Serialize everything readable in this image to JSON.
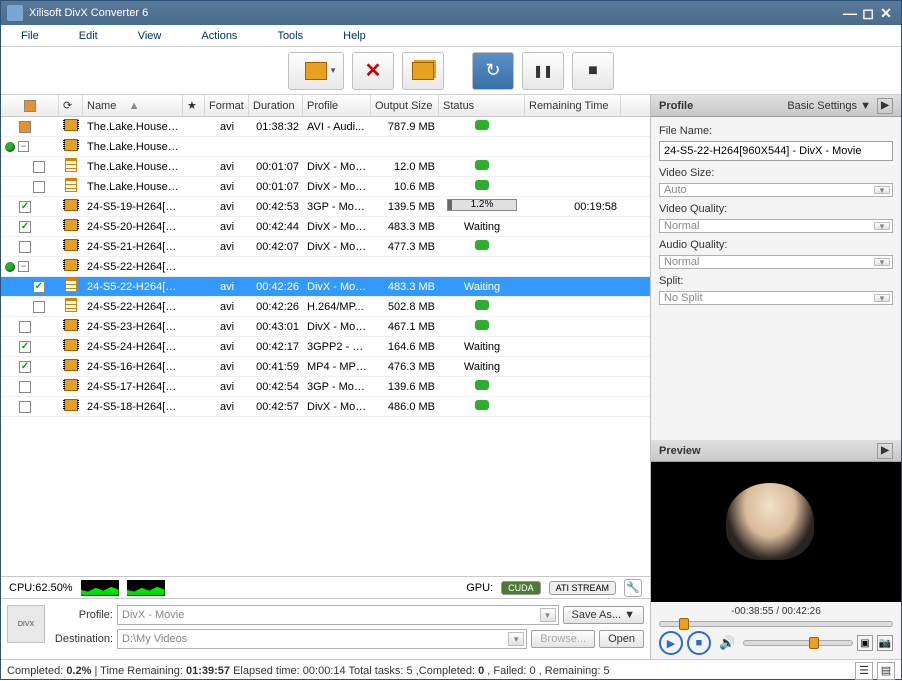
{
  "title": "Xilisoft DivX Converter 6",
  "menu": [
    "File",
    "Edit",
    "View",
    "Actions",
    "Tools",
    "Help"
  ],
  "columns": [
    "",
    "",
    "Name",
    "",
    "Format",
    "Duration",
    "Profile",
    "Output Size",
    "Status",
    "Remaining Time"
  ],
  "sort_indicator": "▲",
  "rows": [
    {
      "tree": "top",
      "chk": "box",
      "ic": "film",
      "name": "The.Lake.House....",
      "fmt": "avi",
      "dur": "01:38:32",
      "prof": "AVI - Audi...",
      "out": "787.9 MB",
      "stat": "dot"
    },
    {
      "tree": "grp",
      "chk": "",
      "ic": "film",
      "name": "The.Lake.House....",
      "fmt": "",
      "dur": "",
      "prof": "",
      "out": "",
      "stat": ""
    },
    {
      "tree": "child",
      "chk": "",
      "ic": "doc",
      "name": "The.Lake.House....",
      "fmt": "avi",
      "dur": "00:01:07",
      "prof": "DivX - Movie",
      "out": "12.0 MB",
      "stat": "dot"
    },
    {
      "tree": "child",
      "chk": "",
      "ic": "doc",
      "name": "The.Lake.House....",
      "fmt": "avi",
      "dur": "00:01:07",
      "prof": "DivX - Movie",
      "out": "10.6 MB",
      "stat": "dot"
    },
    {
      "tree": "item",
      "chk": "on",
      "ic": "film",
      "name": "24-S5-19-H264[9...",
      "fmt": "avi",
      "dur": "00:42:53",
      "prof": "3GP - Mobi...",
      "out": "139.5 MB",
      "stat": "prog",
      "pct": "1.2%",
      "rem": "00:19:58"
    },
    {
      "tree": "item",
      "chk": "on",
      "ic": "film",
      "name": "24-S5-20-H264[9...",
      "fmt": "avi",
      "dur": "00:42:44",
      "prof": "DivX - Movie",
      "out": "483.3 MB",
      "stat": "Waiting"
    },
    {
      "tree": "item",
      "chk": "",
      "ic": "film",
      "name": "24-S5-21-H264[9...",
      "fmt": "avi",
      "dur": "00:42:07",
      "prof": "DivX - Movie",
      "out": "477.3 MB",
      "stat": "dot"
    },
    {
      "tree": "grp",
      "chk": "",
      "ic": "film",
      "name": "24-S5-22-H264[9...",
      "fmt": "",
      "dur": "",
      "prof": "",
      "out": "",
      "stat": ""
    },
    {
      "tree": "child",
      "chk": "on",
      "ic": "doc",
      "name": "24-S5-22-H264[9...",
      "fmt": "avi",
      "dur": "00:42:26",
      "prof": "DivX - Movie",
      "out": "483.3 MB",
      "stat": "Waiting",
      "sel": true
    },
    {
      "tree": "child",
      "chk": "",
      "ic": "doc",
      "name": "24-S5-22-H264[9...",
      "fmt": "avi",
      "dur": "00:42:26",
      "prof": "H.264/MP...",
      "out": "502.8 MB",
      "stat": "dot"
    },
    {
      "tree": "item",
      "chk": "",
      "ic": "film",
      "name": "24-S5-23-H264[9...",
      "fmt": "avi",
      "dur": "00:43:01",
      "prof": "DivX - Movie",
      "out": "467.1 MB",
      "stat": "dot"
    },
    {
      "tree": "item",
      "chk": "on",
      "ic": "film",
      "name": "24-S5-24-H264[9...",
      "fmt": "avi",
      "dur": "00:42:17",
      "prof": "3GPP2 - M...",
      "out": "164.6 MB",
      "stat": "Waiting"
    },
    {
      "tree": "item",
      "chk": "on",
      "ic": "film",
      "name": "24-S5-16-H264[9...",
      "fmt": "avi",
      "dur": "00:41:59",
      "prof": "MP4 - MPE...",
      "out": "476.3 MB",
      "stat": "Waiting"
    },
    {
      "tree": "item",
      "chk": "",
      "ic": "film",
      "name": "24-S5-17-H264[9...",
      "fmt": "avi",
      "dur": "00:42:54",
      "prof": "3GP - Mobi...",
      "out": "139.6 MB",
      "stat": "dot"
    },
    {
      "tree": "item",
      "chk": "",
      "ic": "film",
      "name": "24-S5-18-H264[9...",
      "fmt": "avi",
      "dur": "00:42:57",
      "prof": "DivX - Movie",
      "out": "486.0 MB",
      "stat": "dot"
    }
  ],
  "cpu": {
    "label": "CPU:",
    "value": "62.50%"
  },
  "gpu": {
    "label": "GPU:",
    "cuda": "CUDA",
    "ati": "ATI STREAM"
  },
  "bottom": {
    "profile_label": "Profile:",
    "profile_value": "DivX - Movie",
    "dest_label": "Destination:",
    "dest_value": "D:\\My Videos",
    "saveas": "Save As...",
    "browse": "Browse...",
    "open": "Open"
  },
  "status": {
    "completed_l": "Completed: ",
    "completed_v": "0.2%",
    "time_rem_l": " | Time Remaining: ",
    "time_rem_v": "01:39:57",
    "elapsed_l": " Elapsed time: ",
    "elapsed_v": "00:00:14",
    "tasks_l": " Total tasks: ",
    "tasks_v": "5",
    "comp2_l": " ,Completed: ",
    "comp2_v": "0",
    "fail_l": ", Failed: ",
    "fail_v": "0",
    "rem_l": ", Remaining: ",
    "rem_v": "5"
  },
  "profile_panel": {
    "head": "Profile",
    "settings": "Basic Settings ▼",
    "file_l": "File Name:",
    "file_v": "24-S5-22-H264[960X544] - DivX - Movie",
    "vsize_l": "Video Size:",
    "vsize_v": "Auto",
    "vq_l": "Video Quality:",
    "vq_v": "Normal",
    "aq_l": "Audio Quality:",
    "aq_v": "Normal",
    "split_l": "Split:",
    "split_v": "No Split"
  },
  "preview": {
    "head": "Preview",
    "time": "-00:38:55 / 00:42:26"
  }
}
